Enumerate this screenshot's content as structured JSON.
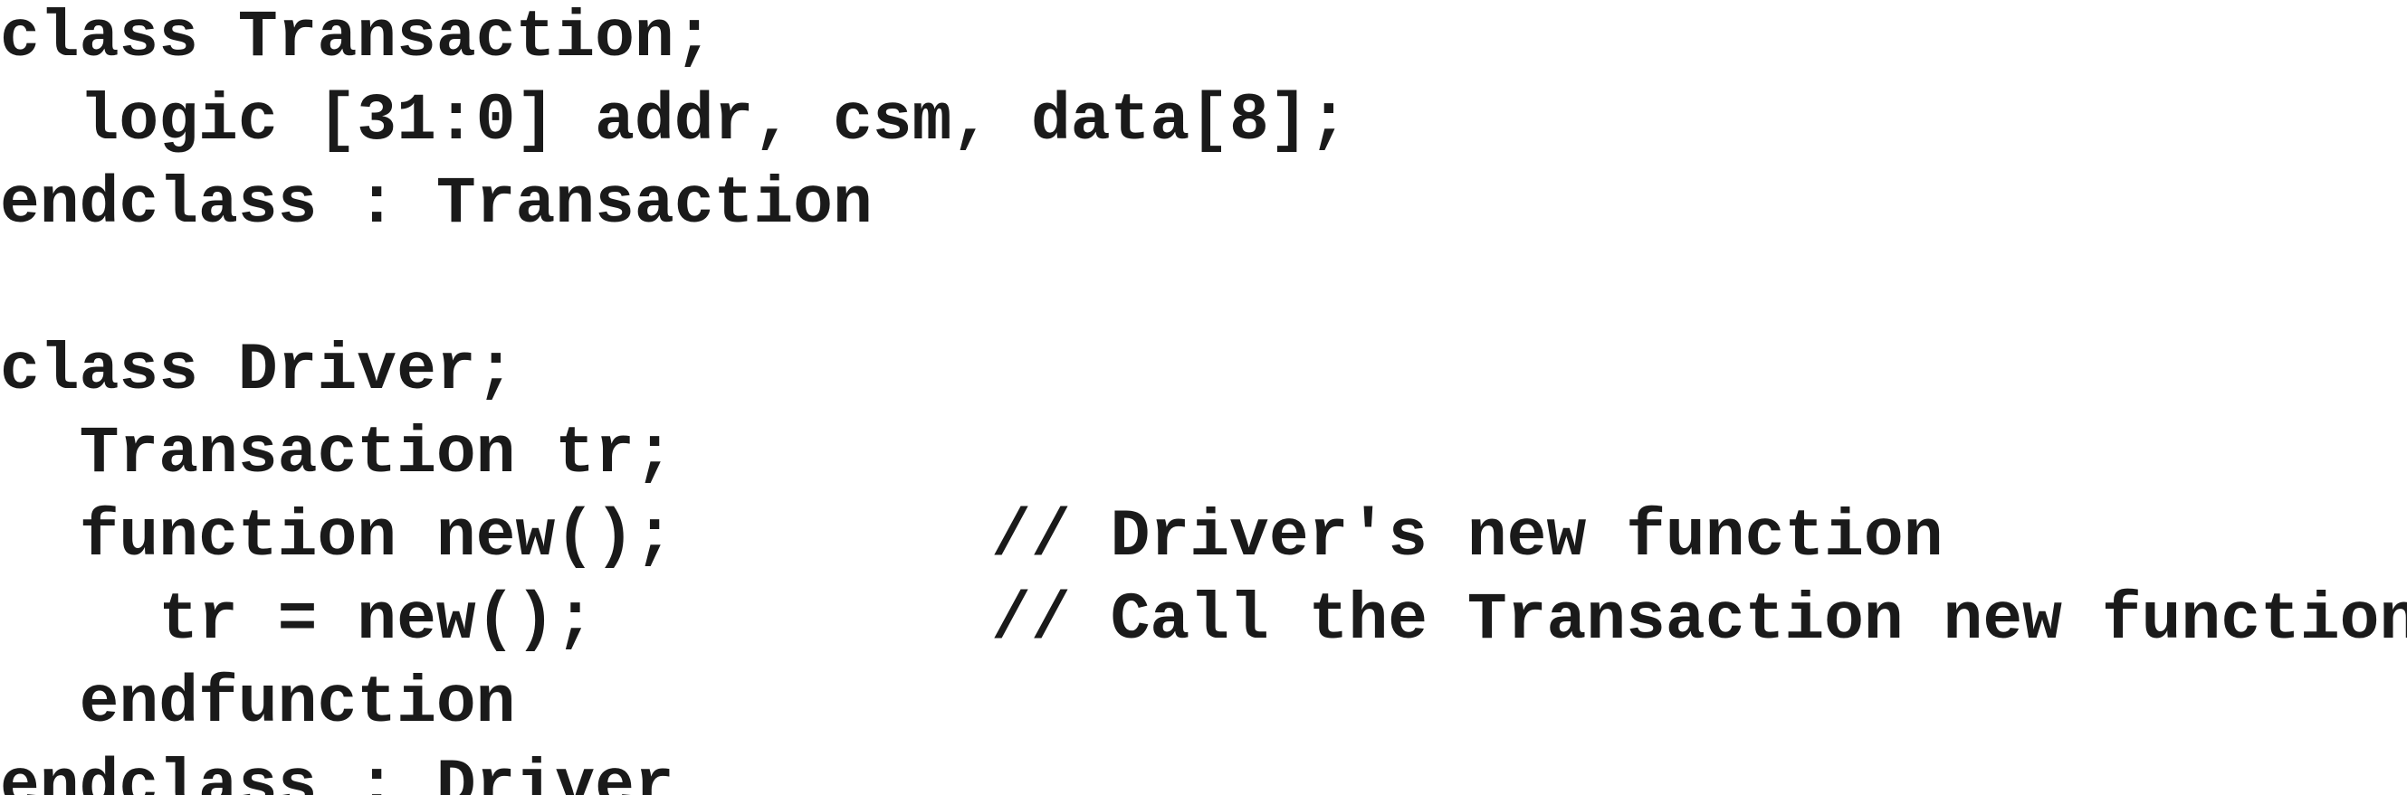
{
  "code": {
    "lines": [
      "class Transaction;",
      "  logic [31:0] addr, csm, data[8];",
      "endclass : Transaction",
      "",
      "class Driver;",
      "  Transaction tr;",
      "  function new();        // Driver's new function",
      "    tr = new();          // Call the Transaction new function",
      "  endfunction",
      "endclass : Driver"
    ]
  }
}
